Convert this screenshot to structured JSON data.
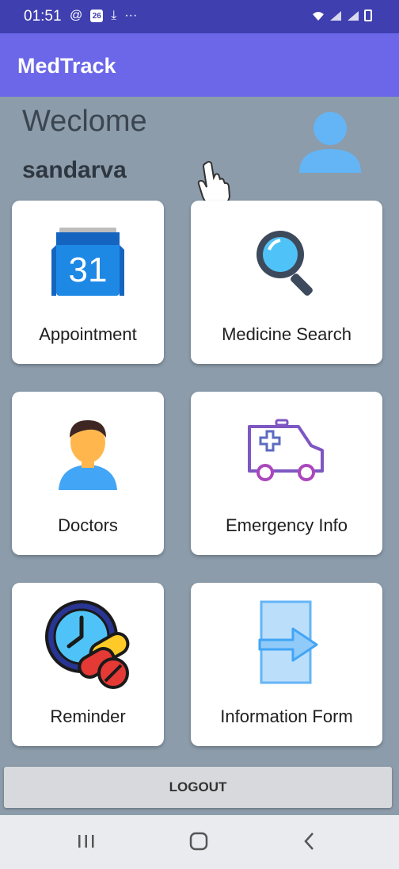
{
  "status_bar": {
    "time": "01:51",
    "left_icons": [
      "at-sign-icon",
      "notification-icon",
      "download-icon",
      "more-dots-icon"
    ],
    "right_icons": [
      "wifi-icon",
      "signal-icon",
      "signal-icon",
      "battery-icon"
    ],
    "notification_badge": "26"
  },
  "app_bar": {
    "title": "MedTrack"
  },
  "header": {
    "welcome": "Weclome",
    "username": "sandarva"
  },
  "grid": {
    "items": [
      {
        "label": "Appointment",
        "icon": "calendar-icon",
        "calendar_day": "31"
      },
      {
        "label": "Medicine Search",
        "icon": "magnifier-icon"
      },
      {
        "label": "Doctors",
        "icon": "doctor-icon"
      },
      {
        "label": "Emergency Info",
        "icon": "ambulance-icon"
      },
      {
        "label": "Reminder",
        "icon": "clock-pills-icon"
      },
      {
        "label": "Information Form",
        "icon": "exit-door-icon"
      }
    ]
  },
  "logout": {
    "label": "LOGOUT"
  },
  "nav_bar": {
    "items": [
      "recent-apps-icon",
      "home-icon",
      "back-icon"
    ]
  },
  "colors": {
    "status_bar": "#3f3fb0",
    "app_bar": "#6b67e8",
    "content_bg": "#8c9cab",
    "card_bg": "#ffffff"
  }
}
